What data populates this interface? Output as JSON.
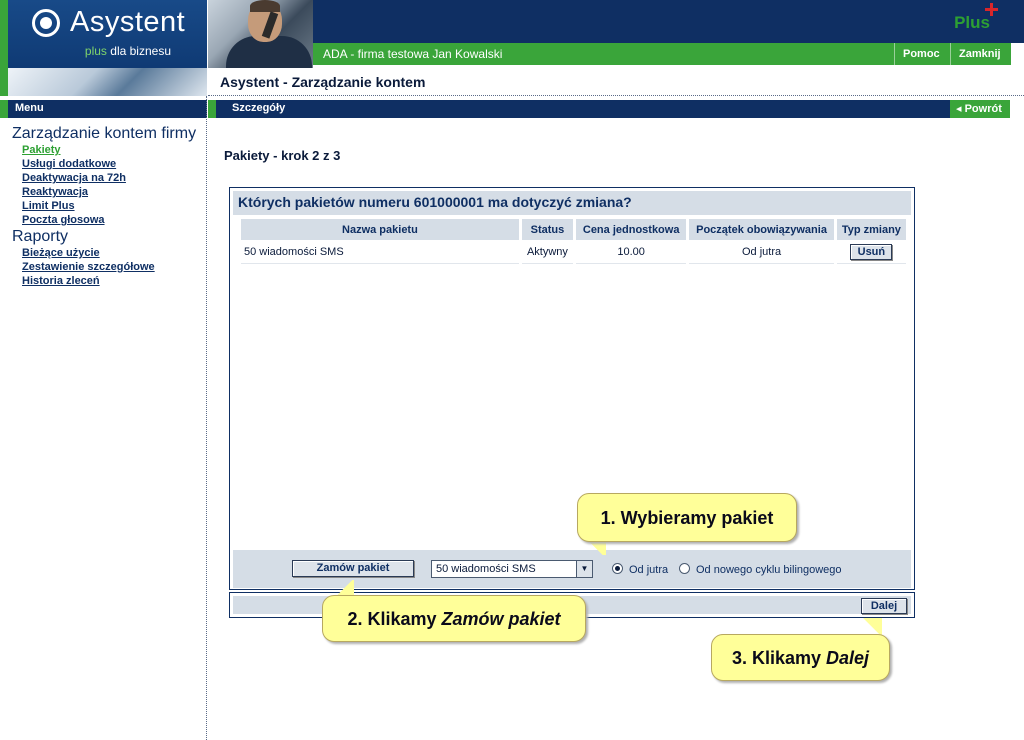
{
  "header": {
    "logo_text": "Asystent",
    "logo_sub_green": "plus",
    "logo_sub_white": "dla biznesu",
    "brand_logo": "Plus",
    "company": "ADA - firma testowa Jan Kowalski",
    "help_label": "Pomoc",
    "close_label": "Zamknij"
  },
  "page_title": "Asystent - Zarządzanie kontem",
  "menu": {
    "title": "Menu",
    "group1": "Zarządzanie kontem firmy",
    "items1": [
      "Pakiety",
      "Usługi dodatkowe",
      "Deaktywacja na 72h",
      "Reaktywacja",
      "Limit Plus",
      "Poczta głosowa"
    ],
    "group2": "Raporty",
    "items2": [
      "Bieżące użycie",
      "Zestawienie szczegółowe",
      "Historia zleceń"
    ]
  },
  "details": {
    "title": "Szczegóły",
    "back_label": "◂ Powrót"
  },
  "main": {
    "step_title": "Pakiety - krok 2 z 3",
    "question": "Których pakietów numeru 601000001 ma dotyczyć zmiana?",
    "table": {
      "headers": [
        "Nazwa pakietu",
        "Status",
        "Cena jednostkowa",
        "Początek obowiązywania",
        "Typ zmiany"
      ],
      "rows": [
        {
          "name": "50 wiadomości SMS",
          "status": "Aktywny",
          "price": "10.00",
          "start": "Od jutra",
          "action": "Usuń"
        }
      ]
    },
    "order_button": "Zamów pakiet",
    "select_value": "50 wiadomości SMS",
    "radio_tomorrow": "Od jutra",
    "radio_cycle": "Od nowego cyklu bilingowego",
    "next_button": "Dalej"
  },
  "callouts": {
    "c1": "1. Wybieramy pakiet",
    "c2_prefix": "2. Klikamy ",
    "c2_em": "Zamów pakiet",
    "c3_prefix": "3. Klikamy ",
    "c3_em": "Dalej"
  },
  "colors": {
    "navy": "#0f2f63",
    "green": "#3aa53a",
    "panel_gray": "#d5dde6",
    "callout_yellow": "#ffff99"
  }
}
